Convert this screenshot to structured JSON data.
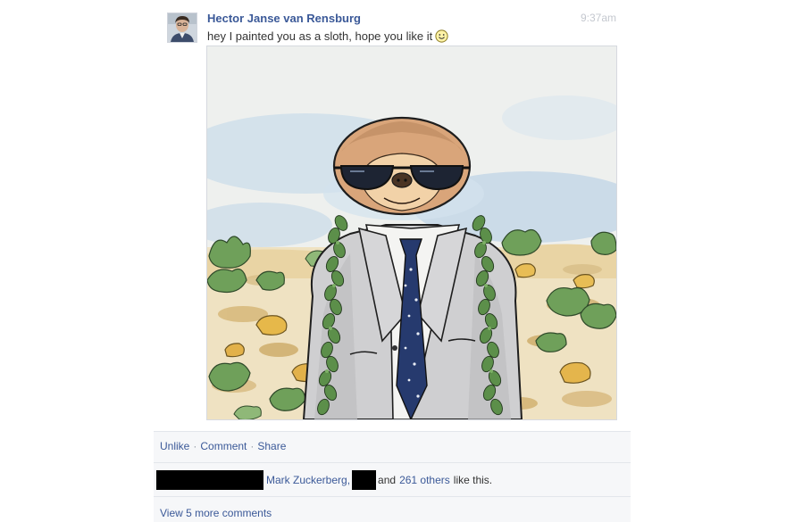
{
  "post": {
    "author": "Hector Janse van Rensburg",
    "timestamp": "9:37am",
    "message": "hey I painted you as a sloth, hope you like it",
    "message_emoji_icon": "smiley-icon",
    "image_alt": "Painting of a sloth wearing sunglasses, a suit and tie, and leaf garlands"
  },
  "actions": {
    "unlike_label": "Unlike",
    "separator": "·",
    "comment_label": "Comment",
    "share_label": "Share"
  },
  "likes": {
    "name_1": "Mark Zuckerberg,",
    "and_label": "and",
    "others_label": "261 others",
    "suffix": "like this."
  },
  "comments": {
    "view_more_label": "View 5 more comments"
  },
  "colors": {
    "link": "#3b5998",
    "timestamp": "#c4c8cf",
    "feedback_bg": "#f6f7f9",
    "redaction": "#000000"
  }
}
